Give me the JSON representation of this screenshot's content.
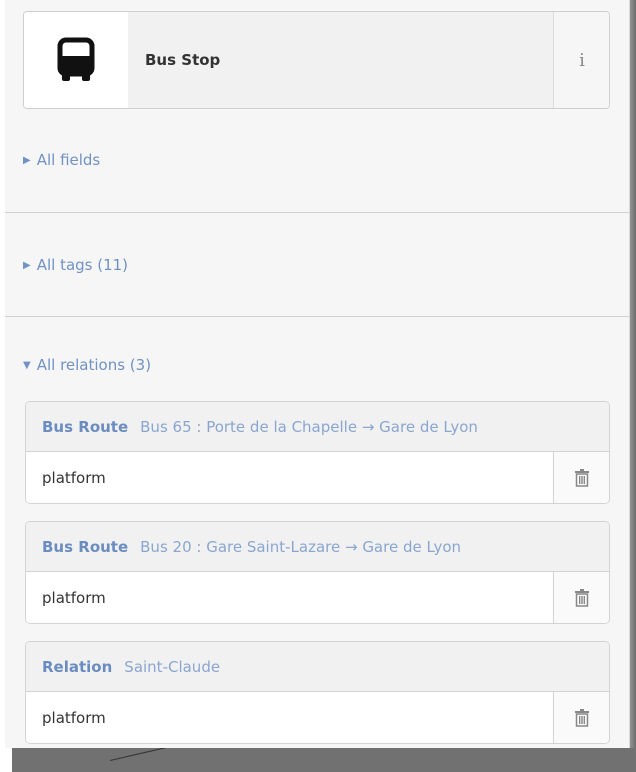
{
  "preset": {
    "name": "Bus Stop",
    "info_label": "i"
  },
  "sections": {
    "fields_label": "All fields",
    "tags_label": "All tags (11)",
    "relations_label": "All relations (3)"
  },
  "relations": [
    {
      "type": "Bus Route",
      "name": "Bus 65 : Porte de la Chapelle → Gare de Lyon",
      "role": "platform"
    },
    {
      "type": "Bus Route",
      "name": "Bus 20 : Gare Saint-Lazare → Gare de Lyon",
      "role": "platform"
    },
    {
      "type": "Relation",
      "name": "Saint-Claude",
      "role": "platform"
    }
  ],
  "colors": {
    "link": "#7092c5",
    "panel_bg": "#f6f6f6"
  }
}
